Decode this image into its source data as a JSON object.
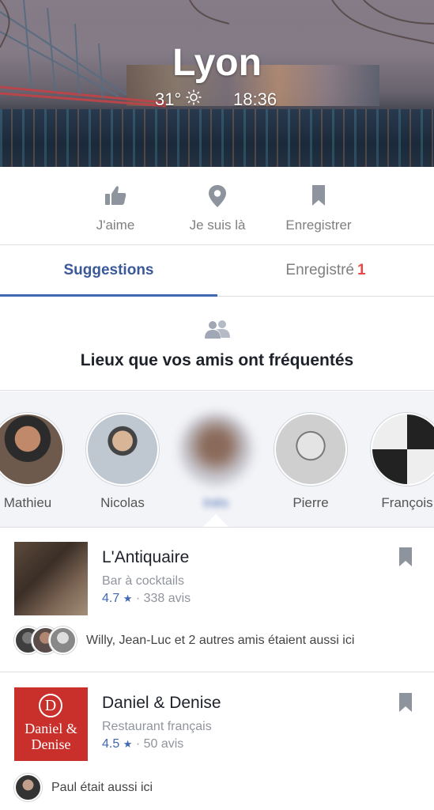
{
  "hero": {
    "city": "Lyon",
    "temperature": "31°",
    "time": "18:36",
    "weather_icon": "sun-icon"
  },
  "actions": [
    {
      "label": "J'aime",
      "icon": "thumbs-up-icon"
    },
    {
      "label": "Je suis là",
      "icon": "location-pin-icon"
    },
    {
      "label": "Enregistrer",
      "icon": "bookmark-icon"
    }
  ],
  "tabs": [
    {
      "label": "Suggestions",
      "active": true
    },
    {
      "label": "Enregistré",
      "badge": "1"
    }
  ],
  "section": {
    "title": "Lieux que vos amis ont fréquentés",
    "icon": "friends-icon"
  },
  "friends": [
    {
      "name": "Mathieu"
    },
    {
      "name": "Nicolas"
    },
    {
      "name": "Inès"
    },
    {
      "name": "Pierre"
    },
    {
      "name": "François"
    }
  ],
  "places": [
    {
      "name": "L'Antiquaire",
      "category": "Bar à cocktails",
      "rating": "4.7",
      "reviews": "· 338 avis",
      "friends_text": "Willy, Jean-Luc et 2 autres amis étaient aussi ici"
    },
    {
      "name": "Daniel & Denise",
      "category": "Restaurant français",
      "rating": "4.5",
      "reviews": "· 50 avis",
      "friends_text": "Paul était aussi ici",
      "logo_letter": "D",
      "logo_text": "Daniel & Denise"
    }
  ],
  "colors": {
    "brand": "#4267b2",
    "tab_active": "#3b5998",
    "badge": "#e84a4a"
  }
}
